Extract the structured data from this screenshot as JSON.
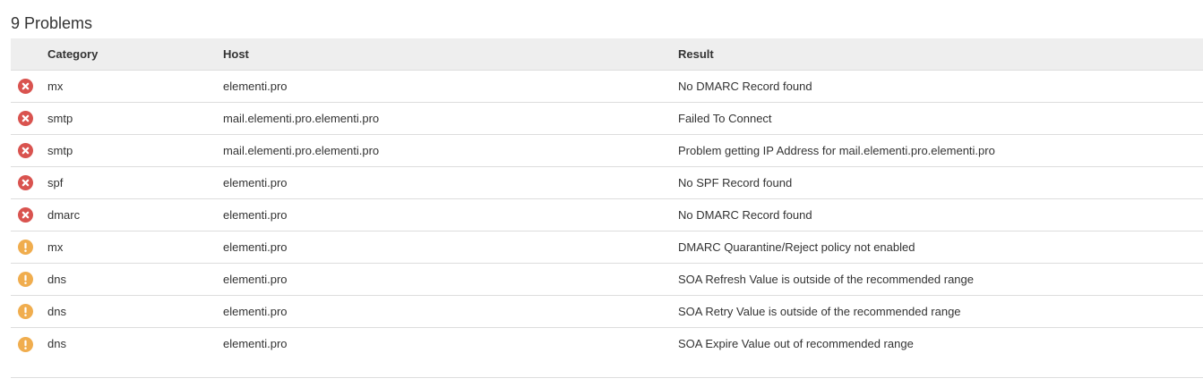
{
  "title": "9 Problems",
  "colors": {
    "error": "#d9534f",
    "warning": "#f0ad4e",
    "header_bg": "#eeeeee"
  },
  "columns": {
    "category": "Category",
    "host": "Host",
    "result": "Result"
  },
  "rows": [
    {
      "status": "error-icon",
      "category": "mx",
      "host": "elementi.pro",
      "result": "No DMARC Record found"
    },
    {
      "status": "error-icon",
      "category": "smtp",
      "host": "mail.elementi.pro.elementi.pro",
      "result": "Failed To Connect"
    },
    {
      "status": "error-icon",
      "category": "smtp",
      "host": "mail.elementi.pro.elementi.pro",
      "result": "Problem getting IP Address for mail.elementi.pro.elementi.pro"
    },
    {
      "status": "error-icon",
      "category": "spf",
      "host": "elementi.pro",
      "result": "No SPF Record found"
    },
    {
      "status": "error-icon",
      "category": "dmarc",
      "host": "elementi.pro",
      "result": "No DMARC Record found"
    },
    {
      "status": "warning-icon",
      "category": "mx",
      "host": "elementi.pro",
      "result": "DMARC Quarantine/Reject policy not enabled"
    },
    {
      "status": "warning-icon",
      "category": "dns",
      "host": "elementi.pro",
      "result": "SOA Refresh Value is outside of the recommended range"
    },
    {
      "status": "warning-icon",
      "category": "dns",
      "host": "elementi.pro",
      "result": "SOA Retry Value is outside of the recommended range"
    },
    {
      "status": "warning-icon",
      "category": "dns",
      "host": "elementi.pro",
      "result": "SOA Expire Value out of recommended range"
    }
  ]
}
